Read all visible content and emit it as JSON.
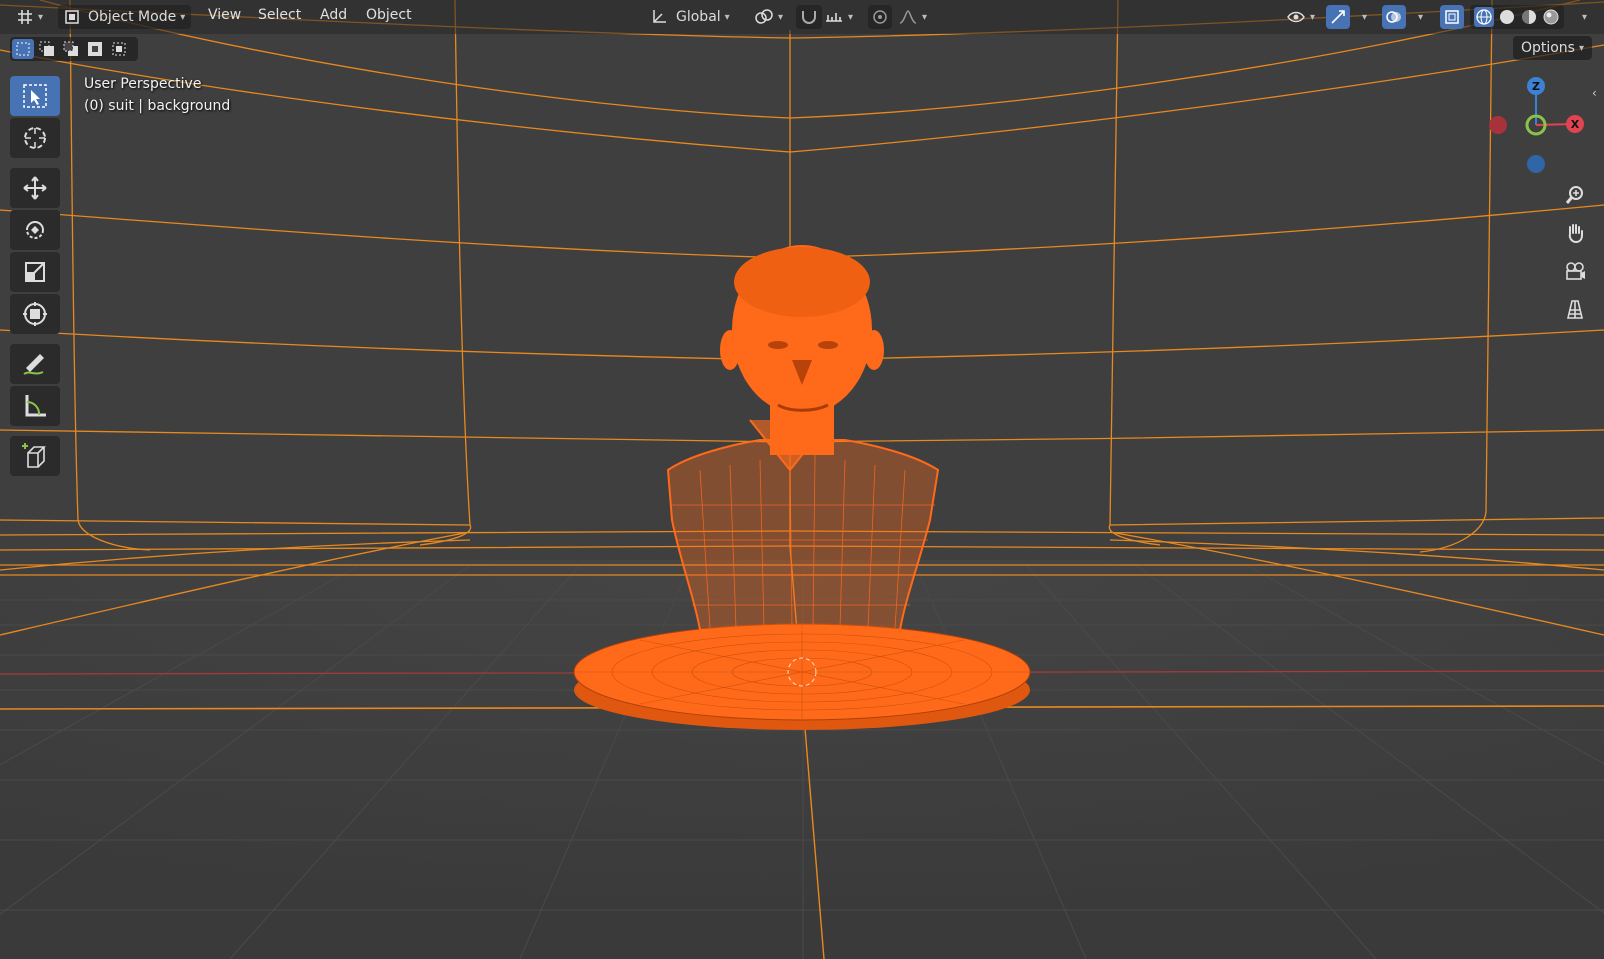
{
  "header": {
    "mode_label": "Object Mode",
    "menus": [
      "View",
      "Select",
      "Add",
      "Object"
    ],
    "transform_orientation": "Global",
    "options_label": "Options"
  },
  "viewport": {
    "perspective_label": "User Perspective",
    "collection_info": "(0) suit | background"
  },
  "gizmo": {
    "z_label": "Z",
    "x_label": "X",
    "colors": {
      "x": "#e04450",
      "y": "#8bc34a",
      "z": "#3b82d4"
    }
  },
  "icons": {
    "editor_type": "grid-editor-icon",
    "toolbar": [
      "select-box-icon",
      "cursor-icon",
      "move-icon",
      "rotate-icon",
      "scale-icon",
      "transform-icon",
      "annotate-icon",
      "measure-icon",
      "add-cube-icon"
    ],
    "nav": [
      "zoom-icon",
      "pan-hand-icon",
      "camera-icon",
      "ortho-grid-icon"
    ]
  },
  "colors": {
    "accent": "#4772b3",
    "selection": "#ff6a00",
    "wire": "#e8891f",
    "background": "#3d3d3d"
  }
}
